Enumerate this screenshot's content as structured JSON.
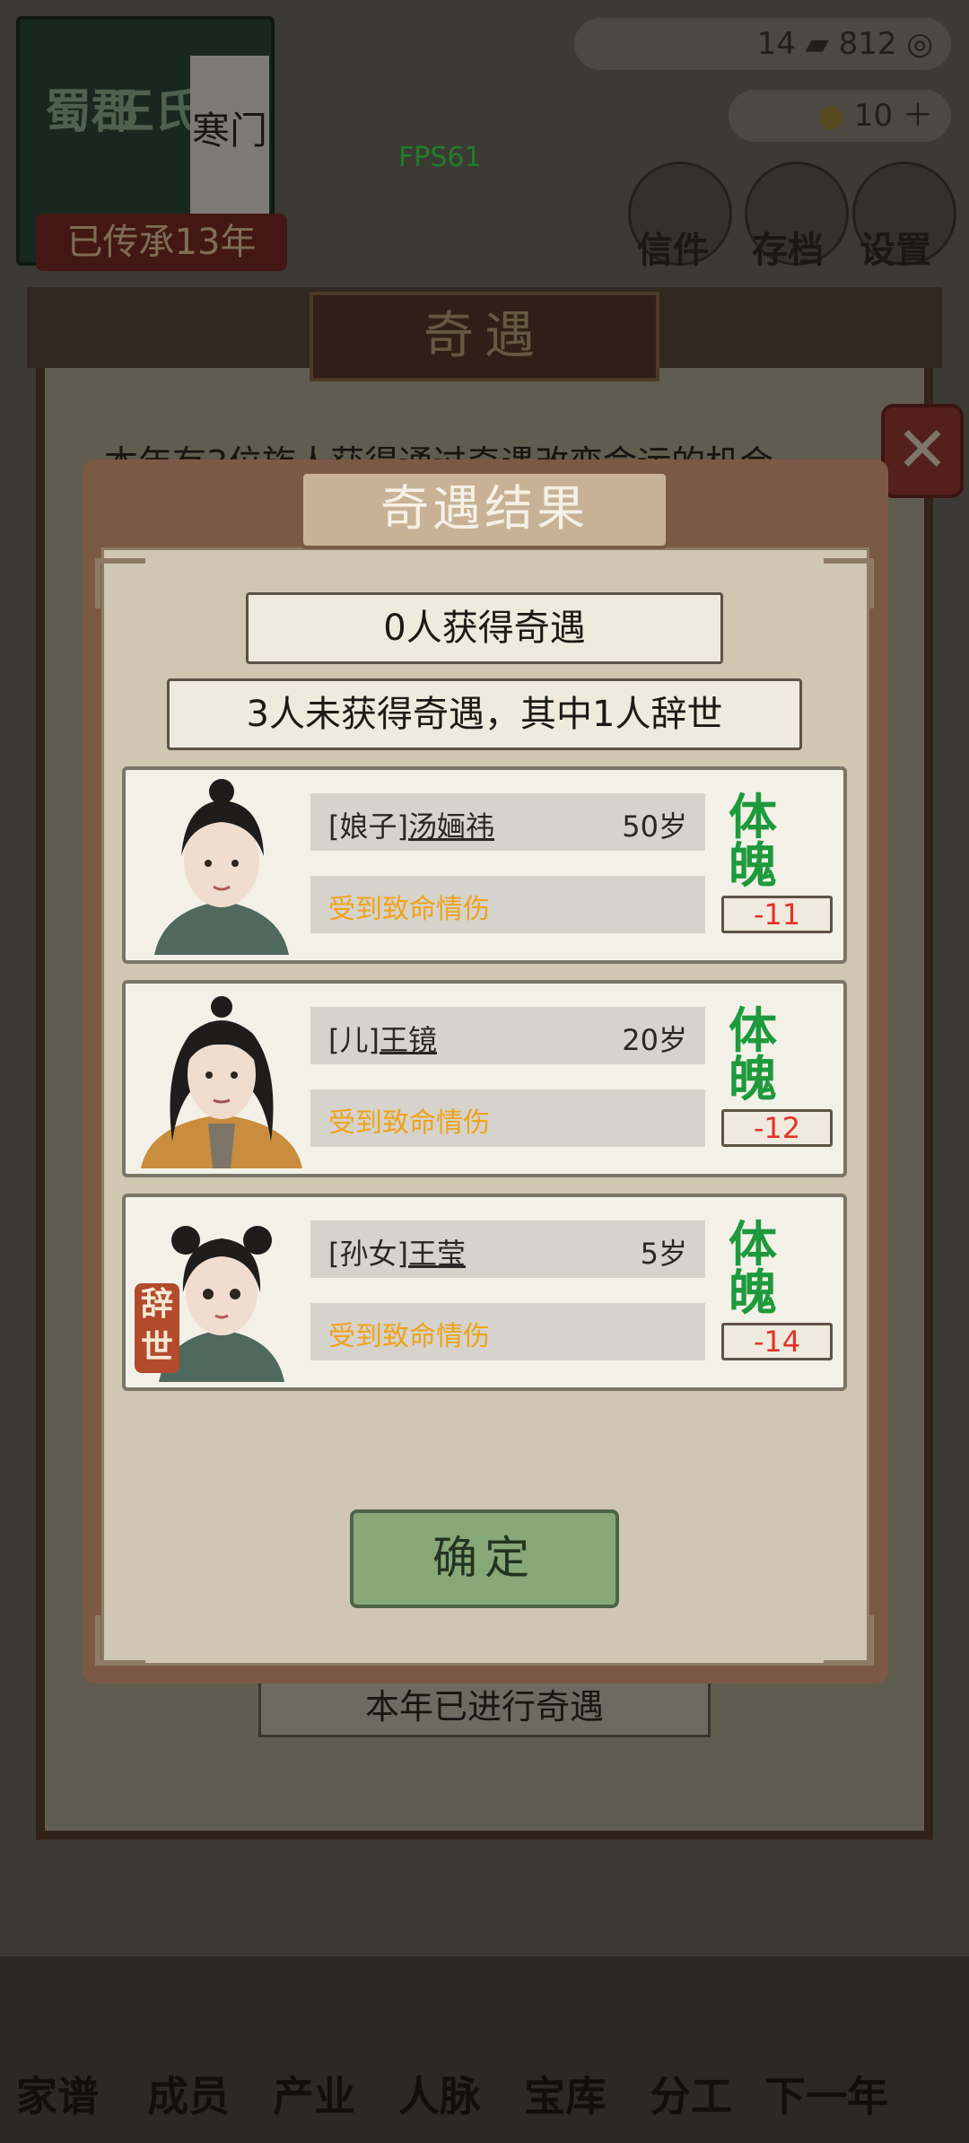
{
  "top": {
    "clan_line1": "蜀郡",
    "clan_line2": "王氏",
    "clan_status": "寒门",
    "inherit": "已传承13年",
    "fps": "FPS61",
    "res1": "14",
    "res2": "812",
    "res3": "10",
    "letters": "信件",
    "save": "存档",
    "settings": "设置"
  },
  "bg_dialog": {
    "title": "奇遇",
    "line": "本年有3位族人获得通过奇遇改变命运的机会",
    "done": "本年已进行奇遇"
  },
  "nav": [
    "家谱",
    "成员",
    "产业",
    "人脉",
    "宝库",
    "分工",
    "下一年"
  ],
  "modal": {
    "title": "奇遇结果",
    "gained": "0人获得奇遇",
    "not_gained": "3人未获得奇遇，其中1人辞世",
    "confirm": "确定",
    "members": [
      {
        "relation": "[娘子]",
        "name": "汤婳祎",
        "age": "50岁",
        "status": "受到致命情伤",
        "attr": "体魄",
        "delta": "-11",
        "died": ""
      },
      {
        "relation": "[儿]",
        "name": "王镜",
        "age": "20岁",
        "status": "受到致命情伤",
        "attr": "体魄",
        "delta": "-12",
        "died": ""
      },
      {
        "relation": "[孙女]",
        "name": "王莹",
        "age": "5岁",
        "status": "受到致命情伤",
        "attr": "体魄",
        "delta": "-14",
        "died": "辞世"
      }
    ]
  },
  "colors": {
    "accent_green": "#1e9a3c",
    "status_orange": "#f0a21a",
    "delta_red": "#e3332a",
    "modal_brown": "#7a5a45"
  }
}
